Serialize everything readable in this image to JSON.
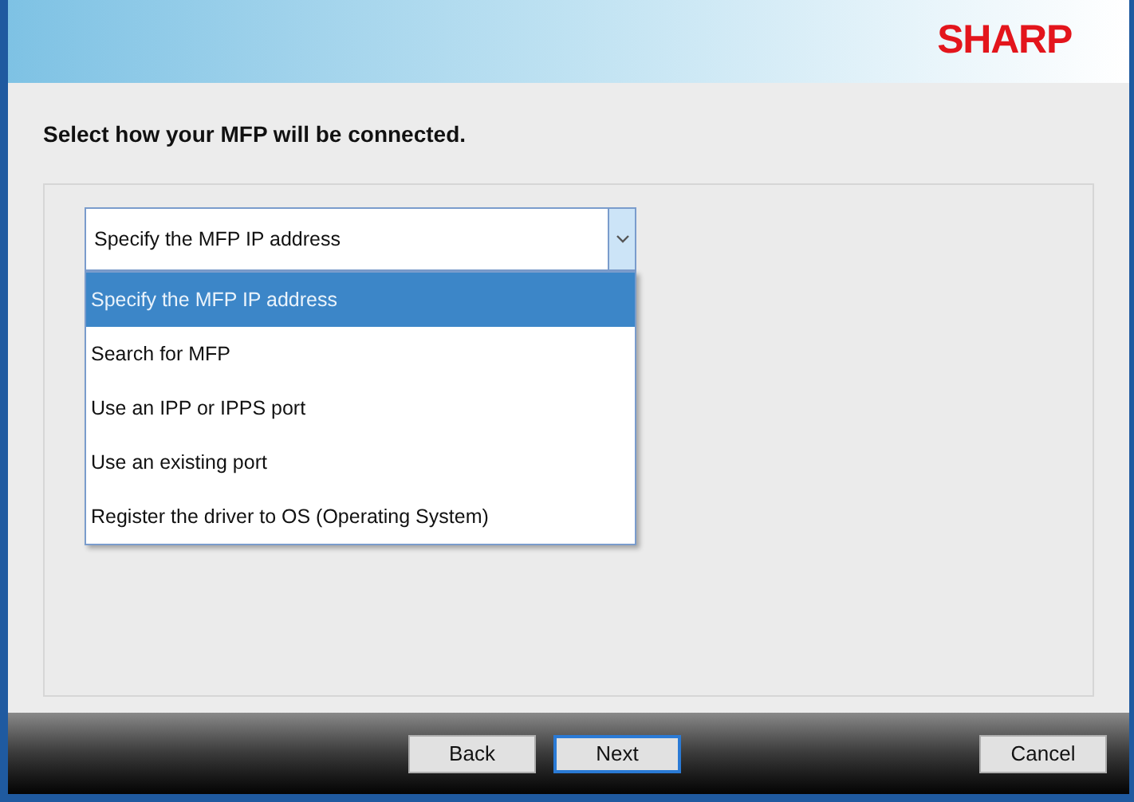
{
  "header": {
    "logo": "SHARP"
  },
  "heading": "Select how your MFP will be connected.",
  "combo": {
    "value": "Specify the MFP IP address",
    "expanded": true,
    "options": [
      {
        "label": "Specify the MFP IP address",
        "selected": true
      },
      {
        "label": "Search for MFP",
        "selected": false
      },
      {
        "label": "Use an IPP or IPPS port",
        "selected": false
      },
      {
        "label": "Use an existing port",
        "selected": false
      },
      {
        "label": "Register the driver to OS (Operating System)",
        "selected": false
      }
    ]
  },
  "buttons": [
    {
      "label": "Back",
      "focused": false
    },
    {
      "label": "Next",
      "focused": true
    },
    {
      "label": "Cancel",
      "focused": false
    }
  ]
}
